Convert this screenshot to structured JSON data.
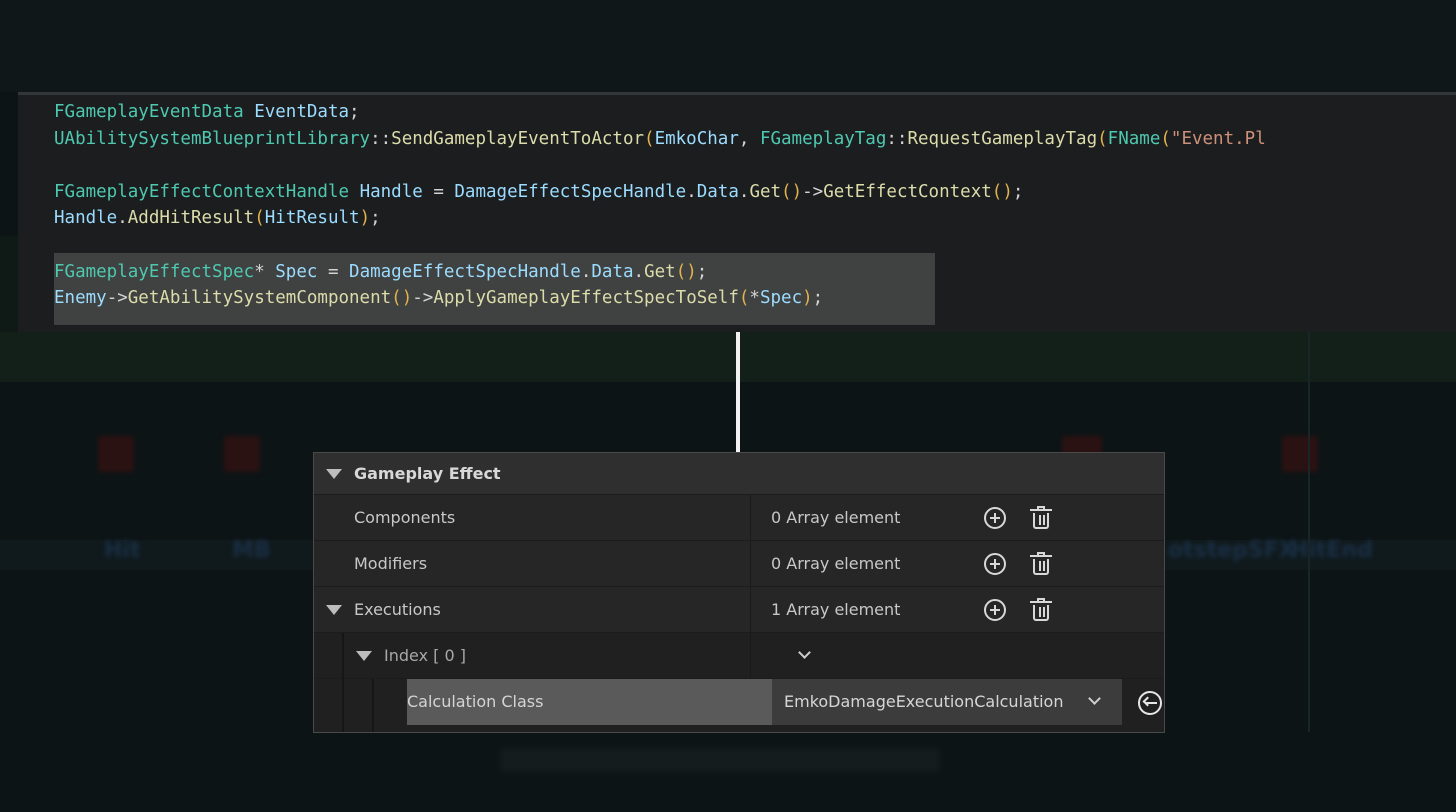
{
  "code_editor": {
    "lines": [
      [
        [
          "FGameplayEventData",
          "type"
        ],
        [
          " ",
          "op"
        ],
        [
          "EventData",
          "var"
        ],
        [
          ";",
          "op"
        ]
      ],
      [
        [
          "UAbilitySystemBlueprintLibrary",
          "type"
        ],
        [
          "::",
          "op"
        ],
        [
          "SendGameplayEventToActor",
          "fn"
        ],
        [
          "(",
          "par"
        ],
        [
          "EmkoChar",
          "var"
        ],
        [
          ", ",
          "op"
        ],
        [
          "FGameplayTag",
          "type"
        ],
        [
          "::",
          "op"
        ],
        [
          "RequestGameplayTag",
          "fn"
        ],
        [
          "(",
          "par"
        ],
        [
          "FName",
          "type"
        ],
        [
          "(",
          "par"
        ],
        [
          "\"Event.Pl",
          "str"
        ]
      ],
      [],
      [
        [
          "FGameplayEffectContextHandle",
          "type"
        ],
        [
          " ",
          "op"
        ],
        [
          "Handle",
          "var"
        ],
        [
          " = ",
          "op"
        ],
        [
          "DamageEffectSpecHandle",
          "var"
        ],
        [
          ".",
          "op"
        ],
        [
          "Data",
          "var"
        ],
        [
          ".",
          "op"
        ],
        [
          "Get",
          "fn"
        ],
        [
          "()",
          "par"
        ],
        [
          "->",
          "op"
        ],
        [
          "GetEffectContext",
          "fn"
        ],
        [
          "()",
          "par"
        ],
        [
          ";",
          "op"
        ]
      ],
      [
        [
          "Handle",
          "var"
        ],
        [
          ".",
          "op"
        ],
        [
          "AddHitResult",
          "fn"
        ],
        [
          "(",
          "par"
        ],
        [
          "HitResult",
          "var"
        ],
        [
          ")",
          "par"
        ],
        [
          ";",
          "op"
        ]
      ],
      [],
      [
        [
          "FGameplayEffectSpec",
          "type"
        ],
        [
          "* ",
          "op"
        ],
        [
          "Spec",
          "var"
        ],
        [
          " = ",
          "op"
        ],
        [
          "DamageEffectSpecHandle",
          "var"
        ],
        [
          ".",
          "op"
        ],
        [
          "Data",
          "var"
        ],
        [
          ".",
          "op"
        ],
        [
          "Get",
          "fn"
        ],
        [
          "()",
          "par"
        ],
        [
          ";",
          "op"
        ]
      ],
      [
        [
          "Enemy",
          "var"
        ],
        [
          "->",
          "op"
        ],
        [
          "GetAbilitySystemComponent",
          "fn"
        ],
        [
          "()",
          "par"
        ],
        [
          "->",
          "op"
        ],
        [
          "ApplyGameplayEffectSpecToSelf",
          "fn"
        ],
        [
          "(",
          "par"
        ],
        [
          "*",
          "op"
        ],
        [
          "Spec",
          "var"
        ],
        [
          ")",
          "par"
        ],
        [
          ";",
          "op"
        ]
      ]
    ]
  },
  "details_panel": {
    "header": "Gameplay Effect",
    "rows": {
      "components": {
        "label": "Components",
        "value": "0 Array element"
      },
      "modifiers": {
        "label": "Modifiers",
        "value": "0 Array element"
      },
      "executions": {
        "label": "Executions",
        "value": "1 Array element"
      },
      "index": {
        "label": "Index [ 0 ]"
      },
      "calculation": {
        "label": "Calculation Class",
        "value": "EmkoDamageExecutionCalculation"
      }
    }
  },
  "background": {
    "pin_labels": [
      "Hit",
      "MB",
      "otstepSFX",
      "HitEnd"
    ]
  },
  "colors": {
    "type": "#4ec9b0",
    "var": "#9cdcfe",
    "fn": "#dcdcaa",
    "op": "#d4d4d4",
    "par": "#e2b34d",
    "str": "#ce9178",
    "panel_bg": "#242424",
    "editor_bg": "#1b1d1f"
  },
  "icons": [
    "expand-triangle-icon",
    "add-element-icon",
    "delete-trash-icon",
    "chevron-down-icon",
    "reset-arrow-icon"
  ]
}
